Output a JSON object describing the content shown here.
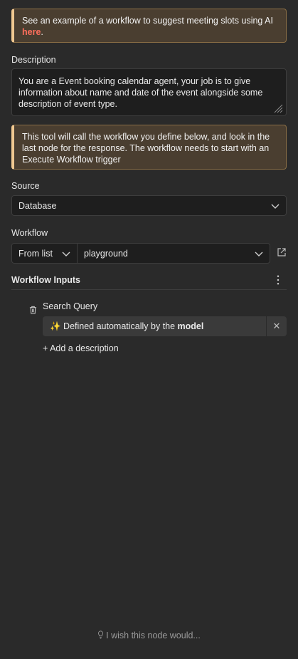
{
  "callout_top": {
    "text": "See an example of a workflow to suggest meeting slots using AI",
    "link": "here",
    "suffix": "."
  },
  "description": {
    "label": "Description",
    "value": "You are a Event booking calendar agent, your job is to give information about name and date of the event alongside some description of event type."
  },
  "callout_info": {
    "text": "This tool will call the workflow you define below, and look in the last node for the response. The workflow needs to start with an Execute Workflow trigger"
  },
  "source": {
    "label": "Source",
    "value": "Database"
  },
  "workflow": {
    "label": "Workflow",
    "mode": "From list",
    "value": "playground"
  },
  "workflow_inputs": {
    "label": "Workflow Inputs",
    "field_name": "Search Query",
    "auto_prefix": "✨ Defined automatically by the ",
    "auto_bold": "model",
    "add_description": "+ Add a description"
  },
  "footer": {
    "text": "I wish this node would..."
  },
  "colors": {
    "background": "#2a2a2a",
    "callout_bg": "#4a3e30",
    "callout_accent": "#f0c890",
    "link": "#ff6f5c"
  }
}
